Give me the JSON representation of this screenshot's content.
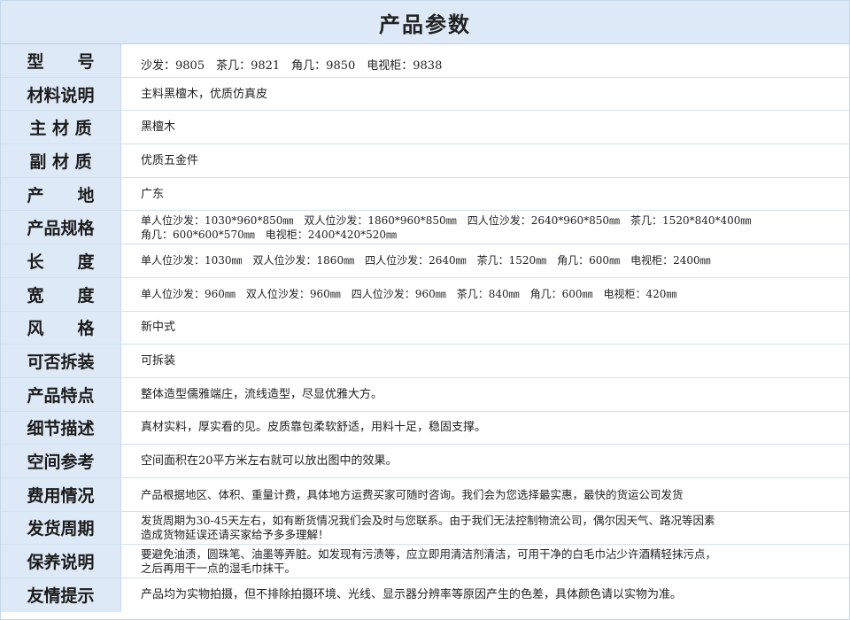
{
  "title": "产品参数",
  "rows": [
    {
      "label": "型　　号",
      "value": "沙发：9805　茶几：9821　角几：9850　电视柜：9838"
    },
    {
      "label": "材料说明",
      "value": "主料黑檀木，优质仿真皮"
    },
    {
      "label": "主 材 质",
      "value": "黑檀木"
    },
    {
      "label": "副 材 质",
      "value": "优质五金件"
    },
    {
      "label": "产　　地",
      "value": "广东"
    },
    {
      "label": "产品规格",
      "value": "单人位沙发：1030*960*850㎜　双人位沙发：1860*960*850㎜　四人位沙发：2640*960*850㎜　茶几：1520*840*400㎜\n角几：600*600*570㎜　电视柜：2400*420*520㎜"
    },
    {
      "label": "长　　度",
      "value": "单人位沙发：1030㎜　双人位沙发：1860㎜　四人位沙发：2640㎜　茶几：1520㎜　角几：600㎜　电视柜：2400㎜"
    },
    {
      "label": "宽　　度",
      "value": "单人位沙发：960㎜　双人位沙发：960㎜　四人位沙发：960㎜　茶几：840㎜　角几：600㎜　电视柜：420㎜"
    },
    {
      "label": "风　　格",
      "value": "新中式"
    },
    {
      "label": "可否拆装",
      "value": "可拆装"
    },
    {
      "label": "产品特点",
      "value": "整体造型儒雅端庄，流线造型，尽显优雅大方。"
    },
    {
      "label": "细节描述",
      "value": "真材实料，厚实看的见。皮质靠包柔软舒适，用料十足，稳固支撑。"
    },
    {
      "label": "空间参考",
      "value": "空间面积在20平方米左右就可以放出图中的效果。"
    },
    {
      "label": "费用情况",
      "value": "产品根据地区、体积、重量计费，具体地方运费买家可随时咨询。我们会为您选择最实惠，最快的货运公司发货"
    },
    {
      "label": "发货周期",
      "value": "发货周期为30-45天左右，如有断货情况我们会及时与您联系。由于我们无法控制物流公司，偶尔因天气、路况等因素\n造成货物延误还请买家给予多多理解！"
    },
    {
      "label": "保养说明",
      "value": "要避免油渍，圆珠笔、油墨等弄脏。如发现有污渍等，应立即用清洁剂清洁，可用干净的白毛巾沾少许酒精轻抹污点，\n之后再用干一点的湿毛巾抹干。"
    },
    {
      "label": "友情提示",
      "value": "产品均为实物拍摄，但不排除拍摄环境、光线、显示器分辨率等原因产生的色差，具体颜色请以实物为准。"
    }
  ]
}
